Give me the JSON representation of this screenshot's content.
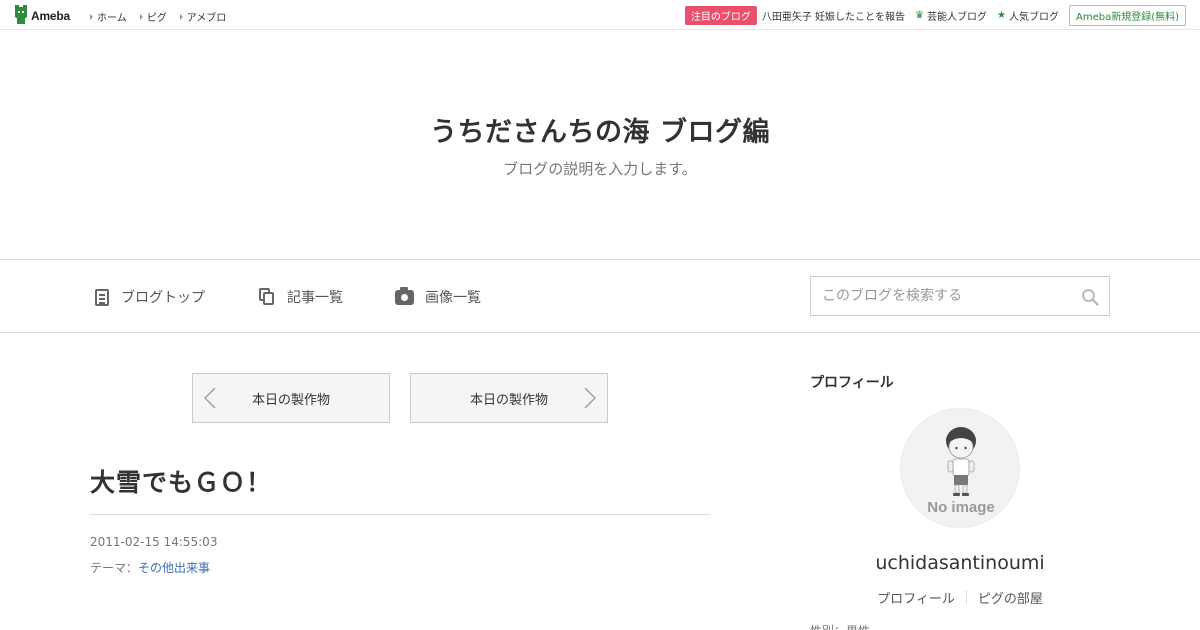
{
  "topbar": {
    "logo_text": "Ameba",
    "nav": [
      "ホーム",
      "ピグ",
      "アメブロ"
    ],
    "hot_badge": "注目のブログ",
    "hot_text": "八田亜矢子 妊娠したことを報告",
    "rank_links": [
      {
        "label": "芸能人ブログ",
        "icon": "crown-icon"
      },
      {
        "label": "人気ブログ",
        "icon": "star-icon"
      }
    ],
    "register": "Ameba新規登録(無料)"
  },
  "header": {
    "title": "うちださんちの海 ブログ編",
    "description": "ブログの説明を入力します。"
  },
  "subnav": {
    "items": [
      {
        "label": "ブログトップ",
        "icon": "document-icon"
      },
      {
        "label": "記事一覧",
        "icon": "copy-icon"
      },
      {
        "label": "画像一覧",
        "icon": "camera-icon"
      }
    ],
    "search_placeholder": "このブログを検索する"
  },
  "pager": {
    "prev_label": "本日の製作物",
    "next_label": "本日の製作物"
  },
  "entry": {
    "title": "大雪でもＧＯ！",
    "date": "2011-02-15 14:55:03",
    "theme_label": "テーマ：",
    "theme": "その他出来事"
  },
  "sidebar": {
    "heading": "プロフィール",
    "avatar_text": "No image",
    "name": "uchidasantinoumi",
    "links": [
      "プロフィール",
      "ピグの部屋"
    ],
    "cut_text": "性別：男性"
  },
  "colors": {
    "accent_green": "#2d8c3c",
    "hot_pink": "#e9506e",
    "link_blue": "#3b6fb6"
  }
}
